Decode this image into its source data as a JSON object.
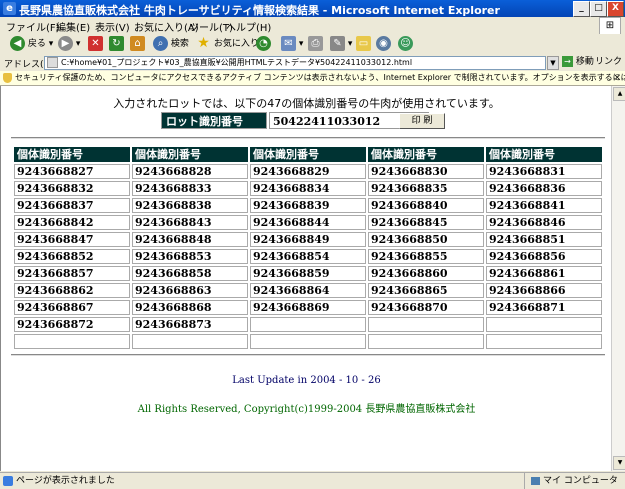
{
  "window": {
    "title": "長野県農協直販株式会社 牛肉トレーサビリティ情報検索結果 - Microsoft Internet Explorer",
    "min": "_",
    "max": "□",
    "close": "X"
  },
  "menu": [
    "ファイル(F)",
    "編集(E)",
    "表示(V)",
    "お気に入り(A)",
    "ツール(T)",
    "ヘルプ(H)"
  ],
  "toolbar": {
    "back": "戻る",
    "search": "検索",
    "favorites": "お気に入り"
  },
  "address": {
    "label": "アドレス(D)",
    "value": "C:¥home¥01_プロジェクト¥03_農協直販¥公開用HTMLテストデータ¥50422411033012.html",
    "go": "移動",
    "links": "リンク"
  },
  "infobar": {
    "text": "セキュリティ保護のため、コンピュータにアクセスできるアクティブ コンテンツは表示されないよう、Internet Explorer で制限されています。オプションを表示するには、ここをクリックしてください...",
    "close": "×"
  },
  "page": {
    "intro": "入力されたロットでは、以下の47の個体識別番号の牛肉が使用されています。",
    "lot_label": "ロット識別番号",
    "lot_value": "50422411033012",
    "print_button": "印 刷",
    "column_header": "個体識別番号",
    "rows": [
      [
        "9243668827",
        "9243668828",
        "9243668829",
        "9243668830",
        "9243668831"
      ],
      [
        "9243668832",
        "9243668833",
        "9243668834",
        "9243668835",
        "9243668836"
      ],
      [
        "9243668837",
        "9243668838",
        "9243668839",
        "9243668840",
        "9243668841"
      ],
      [
        "9243668842",
        "9243668843",
        "9243668844",
        "9243668845",
        "9243668846"
      ],
      [
        "9243668847",
        "9243668848",
        "9243668849",
        "9243668850",
        "9243668851"
      ],
      [
        "9243668852",
        "9243668853",
        "9243668854",
        "9243668855",
        "9243668856"
      ],
      [
        "9243668857",
        "9243668858",
        "9243668859",
        "9243668860",
        "9243668861"
      ],
      [
        "9243668862",
        "9243668863",
        "9243668864",
        "9243668865",
        "9243668866"
      ],
      [
        "9243668867",
        "9243668868",
        "9243668869",
        "9243668870",
        "9243668871"
      ],
      [
        "9243668872",
        "9243668873",
        "",
        "",
        ""
      ],
      [
        "",
        "",
        "",
        "",
        ""
      ]
    ],
    "last_update": "Last Update in 2004 - 10 - 26",
    "copyright": "All Rights Reserved, Copyright(c)1999-2004 長野県農協直販株式会社"
  },
  "status": {
    "text": "ページが表示されました",
    "zone": "マイ コンピュータ"
  }
}
